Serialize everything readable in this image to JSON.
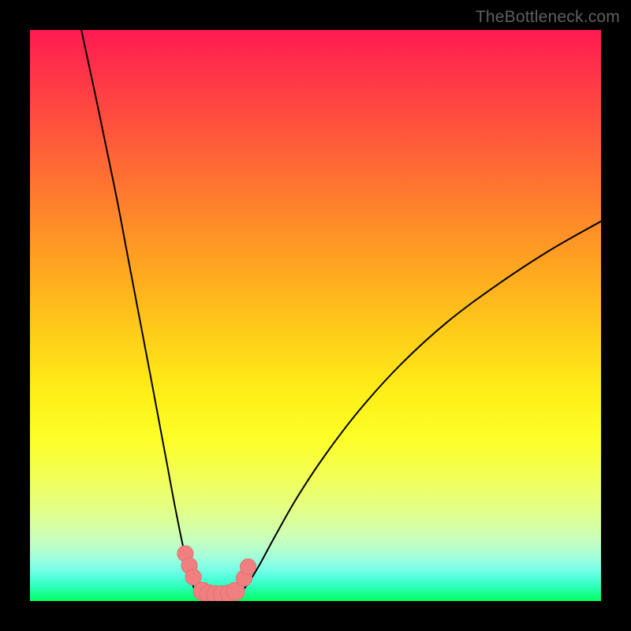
{
  "watermark": "TheBottleneck.com",
  "colors": {
    "background": "#000000",
    "curve_stroke": "#000000",
    "marker_fill": "#f08080",
    "marker_stroke": "#e06a6a"
  },
  "chart_data": {
    "type": "line",
    "title": "",
    "xlabel": "",
    "ylabel": "",
    "xlim": [
      0,
      100
    ],
    "ylim": [
      0,
      100
    ],
    "grid": false,
    "legend": false,
    "series": [
      {
        "name": "left-branch",
        "x": [
          9.0,
          12.0,
          15.0,
          17.0,
          19.0,
          21.0,
          22.5,
          24.0,
          25.3,
          26.5,
          27.5,
          28.3,
          29.0,
          29.8
        ],
        "y": [
          100.0,
          86.0,
          71.5,
          61.0,
          50.5,
          40.0,
          32.0,
          24.0,
          17.0,
          11.0,
          6.5,
          3.5,
          1.6,
          0.7
        ]
      },
      {
        "name": "valley-floor",
        "x": [
          30.0,
          31.0,
          32.0,
          33.0,
          34.0,
          35.0,
          36.0
        ],
        "y": [
          0.35,
          0.25,
          0.22,
          0.22,
          0.25,
          0.35,
          0.55
        ]
      },
      {
        "name": "right-branch",
        "x": [
          36.5,
          38.0,
          40.0,
          43.0,
          47.0,
          52.0,
          58.0,
          65.0,
          73.0,
          82.0,
          91.0,
          100.0
        ],
        "y": [
          1.0,
          2.8,
          6.0,
          11.5,
          18.5,
          26.0,
          33.8,
          41.5,
          48.8,
          55.5,
          61.4,
          66.5
        ]
      }
    ],
    "markers": [
      {
        "x": 27.2,
        "y": 8.3,
        "r": 1.4
      },
      {
        "x": 27.9,
        "y": 6.2,
        "r": 1.4
      },
      {
        "x": 28.6,
        "y": 4.2,
        "r": 1.4
      },
      {
        "x": 30.2,
        "y": 1.7,
        "r": 1.6
      },
      {
        "x": 31.3,
        "y": 1.25,
        "r": 1.6
      },
      {
        "x": 32.5,
        "y": 1.1,
        "r": 1.6
      },
      {
        "x": 33.7,
        "y": 1.1,
        "r": 1.6
      },
      {
        "x": 34.9,
        "y": 1.25,
        "r": 1.6
      },
      {
        "x": 36.0,
        "y": 1.7,
        "r": 1.6
      },
      {
        "x": 37.5,
        "y": 4.0,
        "r": 1.4
      },
      {
        "x": 38.2,
        "y": 6.0,
        "r": 1.4
      }
    ]
  }
}
